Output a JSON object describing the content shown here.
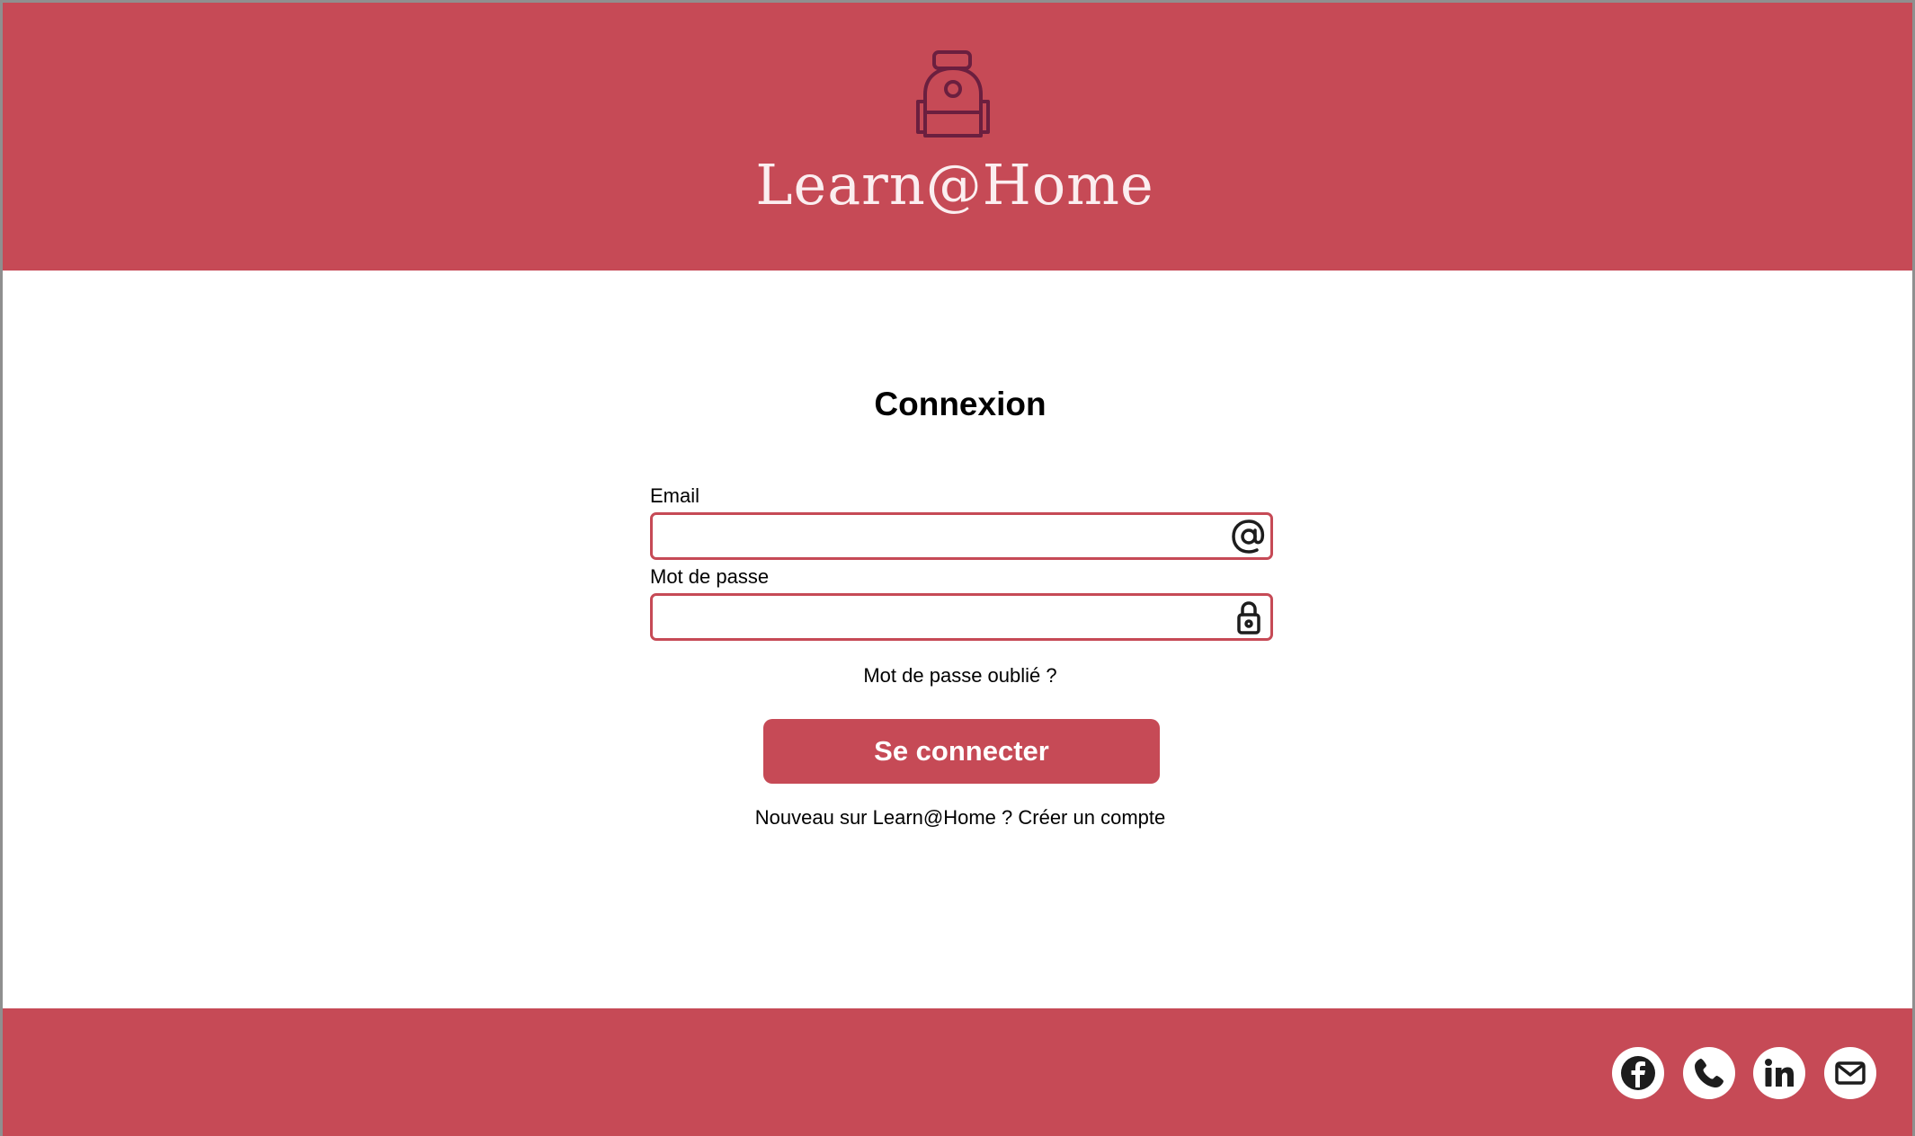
{
  "header": {
    "brand": "Learn@Home",
    "logo_icon": "backpack-icon",
    "background_color": "#c64a56"
  },
  "login": {
    "title": "Connexion",
    "email_label": "Email",
    "email_value": "",
    "email_icon": "at-sign-icon",
    "password_label": "Mot de passe",
    "password_value": "",
    "password_icon": "lock-icon",
    "forgot_link": "Mot de passe oublié ?",
    "submit_label": "Se connecter",
    "signup_prompt": "Nouveau sur Learn@Home ?",
    "signup_link": "Créer un compte"
  },
  "footer": {
    "social_icons": [
      "facebook-icon",
      "phone-icon",
      "linkedin-icon",
      "mail-icon"
    ]
  },
  "colors": {
    "accent": "#c64a56",
    "logo_stroke": "#6b1f3f"
  }
}
